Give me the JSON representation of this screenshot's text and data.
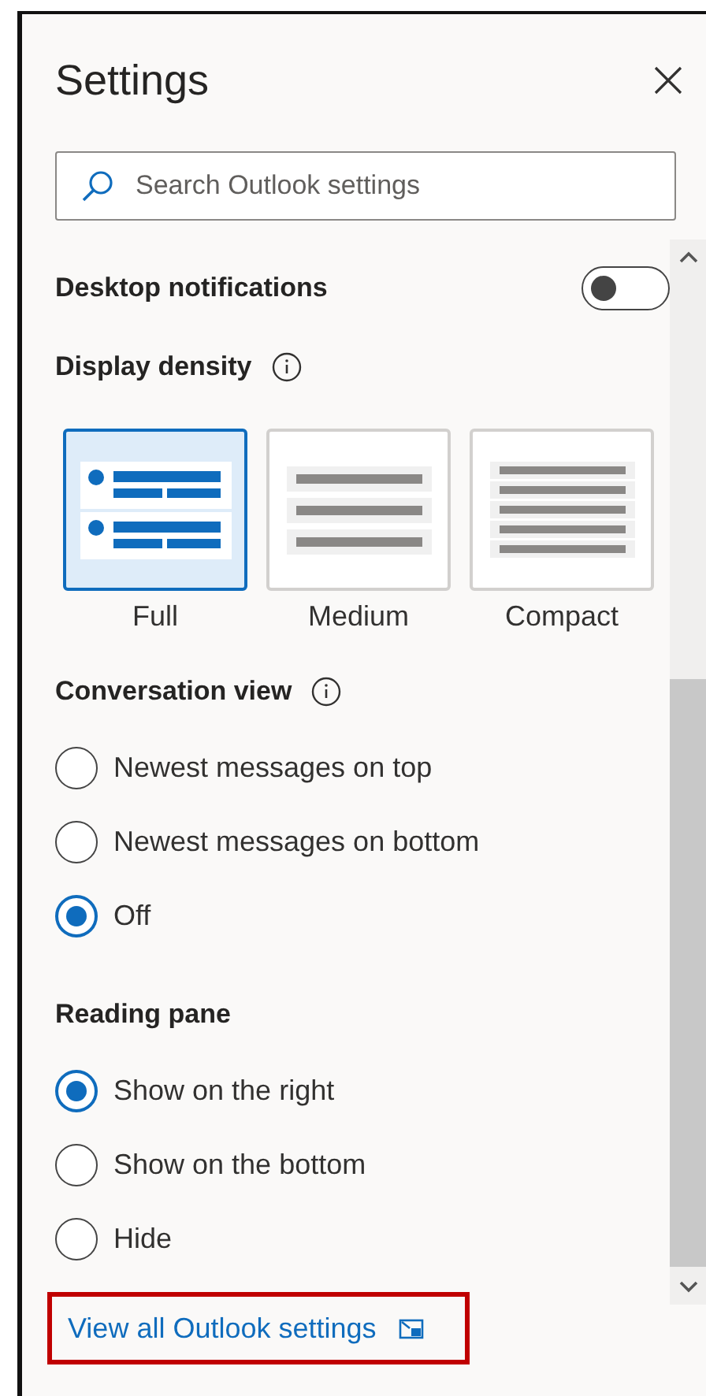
{
  "panel": {
    "title": "Settings"
  },
  "search": {
    "placeholder": "Search Outlook settings"
  },
  "sections": [
    {
      "kind": "toggle",
      "label": "Desktop notifications",
      "on": false
    },
    {
      "kind": "density",
      "label": "Display density",
      "info": true,
      "options": [
        {
          "label": "Full",
          "selected": true
        },
        {
          "label": "Medium",
          "selected": false
        },
        {
          "label": "Compact",
          "selected": false
        }
      ]
    },
    {
      "kind": "radio",
      "label": "Conversation view",
      "info": true,
      "options": [
        {
          "label": "Newest messages on top",
          "selected": false
        },
        {
          "label": "Newest messages on bottom",
          "selected": false
        },
        {
          "label": "Off",
          "selected": true
        }
      ]
    },
    {
      "kind": "radio",
      "label": "Reading pane",
      "options": [
        {
          "label": "Show on the right",
          "selected": true
        },
        {
          "label": "Show on the bottom",
          "selected": false
        },
        {
          "label": "Hide",
          "selected": false
        }
      ]
    }
  ],
  "footer_link": {
    "label": "View all Outlook settings",
    "highlighted": true
  }
}
